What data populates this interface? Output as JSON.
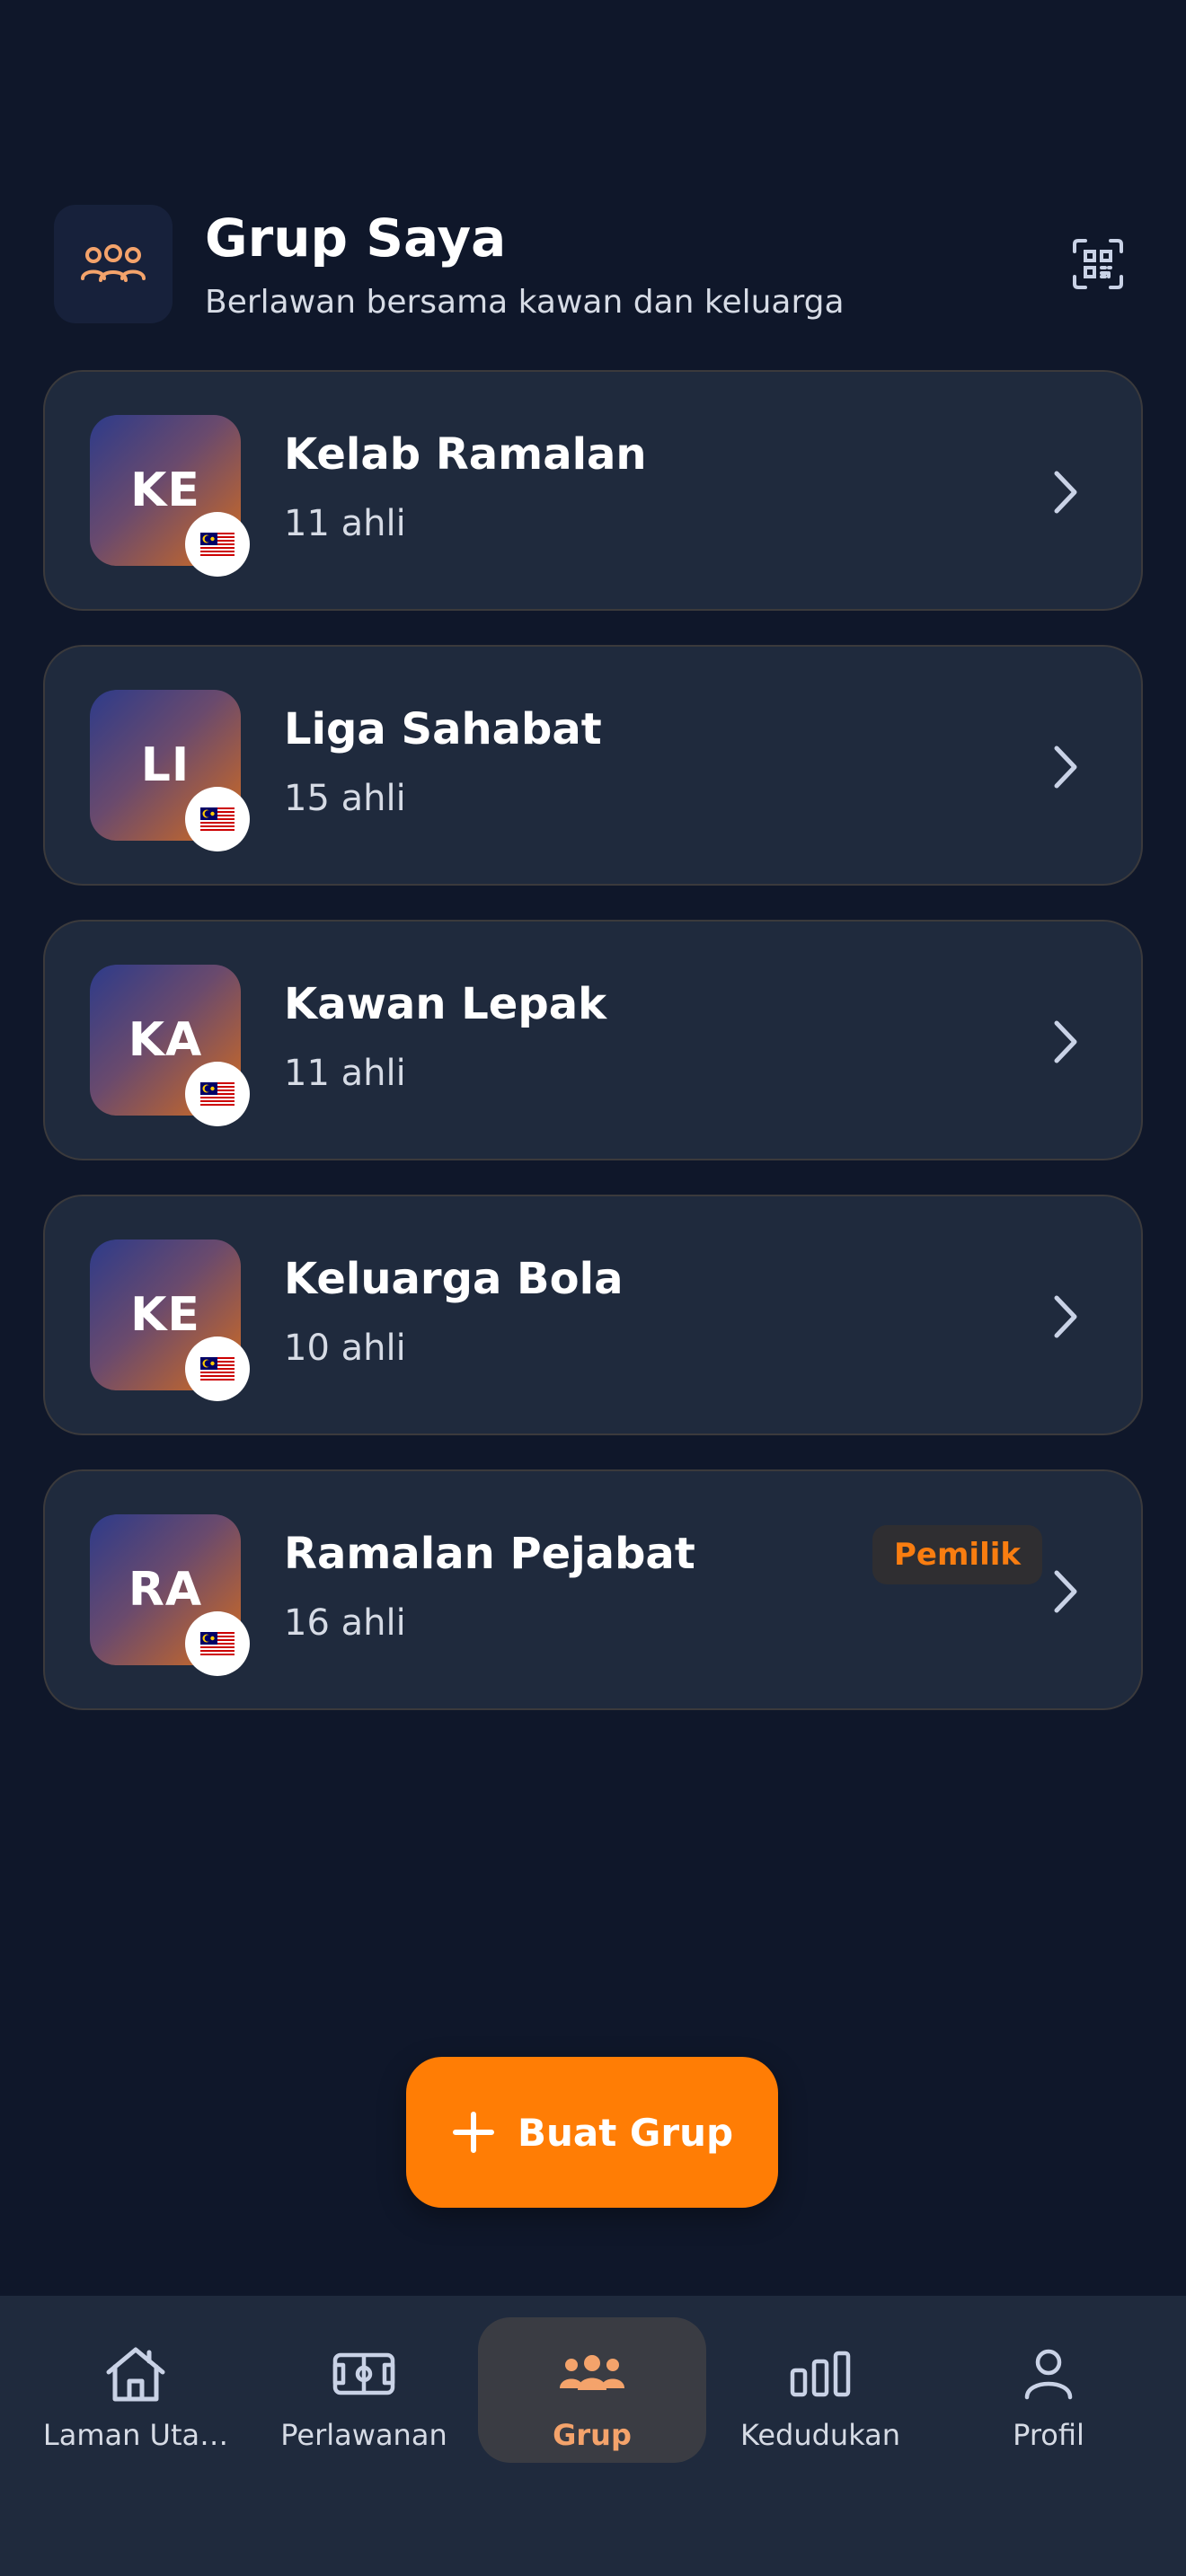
{
  "header": {
    "title": "Grup Saya",
    "subtitle": "Berlawan bersama kawan dan keluarga",
    "icon": "users-icon",
    "qr_icon": "qr-scan-icon"
  },
  "groups": [
    {
      "initials": "KE",
      "name": "Kelab Ramalan",
      "members": "11 ahli",
      "flag": "🇲🇾",
      "badge": ""
    },
    {
      "initials": "LI",
      "name": "Liga Sahabat",
      "members": "15 ahli",
      "flag": "🇲🇾",
      "badge": ""
    },
    {
      "initials": "KA",
      "name": "Kawan Lepak",
      "members": "11 ahli",
      "flag": "🇲🇾",
      "badge": ""
    },
    {
      "initials": "KE",
      "name": "Keluarga Bola",
      "members": "10 ahli",
      "flag": "🇲🇾",
      "badge": ""
    },
    {
      "initials": "RA",
      "name": "Ramalan Pejabat",
      "members": "16 ahli",
      "flag": "🇲🇾",
      "badge": "Pemilik"
    }
  ],
  "create_button": {
    "label": "Buat Grup",
    "icon": "plus-icon"
  },
  "nav": {
    "items": [
      {
        "label": "Laman Uta…",
        "icon": "home-icon",
        "active": false
      },
      {
        "label": "Perlawanan",
        "icon": "pitch-icon",
        "active": false
      },
      {
        "label": "Grup",
        "icon": "users-icon",
        "active": true
      },
      {
        "label": "Kedudukan",
        "icon": "bar-chart-icon",
        "active": false
      },
      {
        "label": "Profil",
        "icon": "user-icon",
        "active": false
      }
    ]
  },
  "colors": {
    "background": "#0f172a",
    "card": "#1f2a3d",
    "accent": "#ff7d05",
    "active_nav_text": "#f4a36b"
  }
}
